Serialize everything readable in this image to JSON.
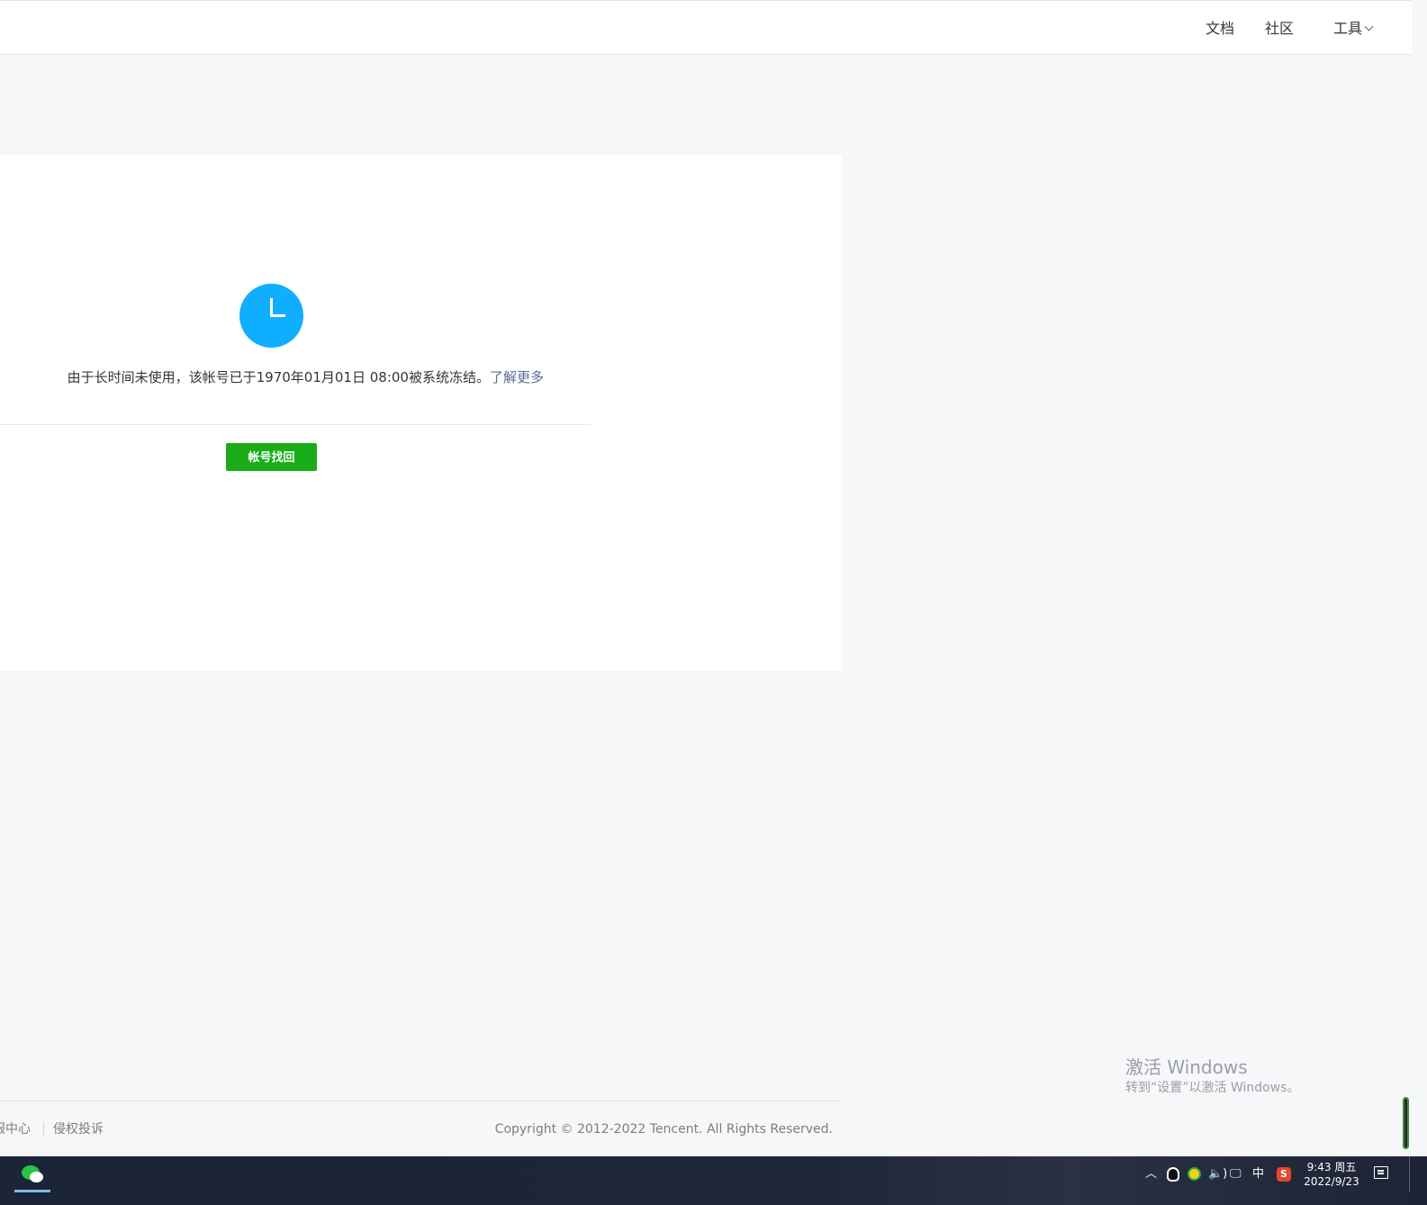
{
  "header": {
    "nav": {
      "docs": "文档",
      "community": "社区",
      "tools": "工具"
    }
  },
  "notice": {
    "icon": "clock-icon",
    "message": "由于长时间未使用，该帐号已于1970年01月01日 08:00被系统冻结。",
    "learn_more": "了解更多",
    "recover_button": "帐号找回"
  },
  "footer": {
    "service_center": "服中心",
    "complaint": "侵权投诉",
    "copyright": "Copyright © 2012-2022 Tencent. All Rights Reserved."
  },
  "watermark": {
    "title": "激活 Windows",
    "subtitle": "转到“设置”以激活 Windows。"
  },
  "taskbar": {
    "pinned_app": "wechat-icon",
    "tray": {
      "volume": "🔈)",
      "ime": "中",
      "sogou": "S"
    },
    "time": "9:43 周五",
    "date": "2022/9/23"
  },
  "colors": {
    "accent_blue": "#10aeff",
    "button_green": "#1aad19",
    "link": "#576b95"
  }
}
